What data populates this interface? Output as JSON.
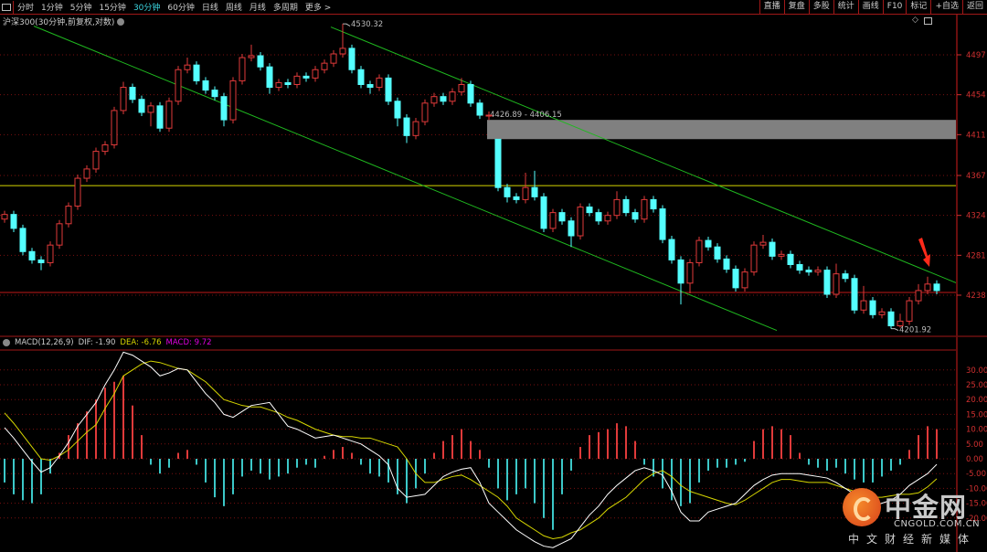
{
  "toolbar": {
    "tabs": [
      "分时",
      "1分钟",
      "5分钟",
      "15分钟",
      "30分钟",
      "60分钟",
      "日线",
      "周线",
      "月线",
      "多周期",
      "更多 >"
    ],
    "active_tab": "30分钟",
    "right_buttons": [
      "直播",
      "复盘",
      "多股",
      "统计",
      "画线",
      "F10",
      "标记",
      "+自选",
      "返回"
    ]
  },
  "subtitle": "沪深300(30分钟,前复权,对数)",
  "macd_header": {
    "name": "MACD(12,26,9)",
    "dif": "DIF: -1.90",
    "dea": "DEA: -6.76",
    "macd": "MACD: 9.72"
  },
  "colors": {
    "background": "#000000",
    "up": "#e03a3a",
    "down": "#54ffff",
    "grid": "#7a1010",
    "axis_text": "#d03030",
    "channel": "#1fb81f",
    "dif": "#ffffff",
    "dea": "#d6d600",
    "macd_text": "#e000e0",
    "gap_box": "#808080",
    "arrow": "#ff2a1a"
  },
  "watermark": {
    "brand": "中金网",
    "url": "CNGOLD.COM.CN",
    "slogan": "中文财经新媒体"
  },
  "chart_data": [
    {
      "type": "candlestick",
      "title": "沪深300(30分钟,前复权,对数)",
      "y_scale": "log",
      "y_ticks": [
        4497,
        4454,
        4411,
        4367,
        4324,
        4281,
        4238
      ],
      "grid": true,
      "candles_ohlc": [
        [
          4320,
          4329,
          4316,
          4325
        ],
        [
          4325,
          4329,
          4306,
          4310
        ],
        [
          4310,
          4314,
          4281,
          4285
        ],
        [
          4285,
          4289,
          4272,
          4276
        ],
        [
          4276,
          4280,
          4265,
          4273
        ],
        [
          4273,
          4296,
          4269,
          4292
        ],
        [
          4292,
          4319,
          4288,
          4315
        ],
        [
          4315,
          4338,
          4311,
          4334
        ],
        [
          4334,
          4368,
          4330,
          4364
        ],
        [
          4364,
          4378,
          4360,
          4374
        ],
        [
          4374,
          4397,
          4370,
          4393
        ],
        [
          4393,
          4404,
          4389,
          4400
        ],
        [
          4400,
          4441,
          4396,
          4437
        ],
        [
          4437,
          4468,
          4433,
          4462
        ],
        [
          4462,
          4466,
          4445,
          4449
        ],
        [
          4449,
          4453,
          4431,
          4435
        ],
        [
          4435,
          4446,
          4420,
          4442
        ],
        [
          4442,
          4446,
          4414,
          4418
        ],
        [
          4418,
          4451,
          4414,
          4447
        ],
        [
          4447,
          4485,
          4443,
          4481
        ],
        [
          4481,
          4494,
          4477,
          4486
        ],
        [
          4486,
          4490,
          4465,
          4469
        ],
        [
          4469,
          4473,
          4455,
          4459
        ],
        [
          4459,
          4463,
          4448,
          4452
        ],
        [
          4452,
          4456,
          4420,
          4427
        ],
        [
          4427,
          4473,
          4423,
          4469
        ],
        [
          4469,
          4498,
          4465,
          4494
        ],
        [
          4494,
          4508,
          4490,
          4496
        ],
        [
          4496,
          4500,
          4480,
          4484
        ],
        [
          4484,
          4488,
          4455,
          4462
        ],
        [
          4462,
          4471,
          4458,
          4467
        ],
        [
          4467,
          4471,
          4461,
          4465
        ],
        [
          4465,
          4478,
          4461,
          4474
        ],
        [
          4474,
          4478,
          4468,
          4472
        ],
        [
          4472,
          4485,
          4468,
          4481
        ],
        [
          4481,
          4492,
          4477,
          4488
        ],
        [
          4488,
          4502,
          4484,
          4498
        ],
        [
          4498,
          4530.32,
          4494,
          4504
        ],
        [
          4504,
          4508,
          4477,
          4481
        ],
        [
          4481,
          4485,
          4461,
          4465
        ],
        [
          4465,
          4469,
          4455,
          4462
        ],
        [
          4462,
          4476,
          4458,
          4472
        ],
        [
          4472,
          4476,
          4443,
          4447
        ],
        [
          4447,
          4451,
          4420,
          4429
        ],
        [
          4429,
          4433,
          4402,
          4410
        ],
        [
          4410,
          4429,
          4406,
          4425
        ],
        [
          4425,
          4449,
          4421,
          4445
        ],
        [
          4445,
          4456,
          4441,
          4452
        ],
        [
          4452,
          4456,
          4443,
          4447
        ],
        [
          4447,
          4461,
          4443,
          4457
        ],
        [
          4457,
          4472,
          4453,
          4465
        ],
        [
          4465,
          4469,
          4441,
          4445
        ],
        [
          4445,
          4449,
          4428,
          4432
        ],
        [
          4432,
          4436,
          4426.89,
          4432
        ],
        [
          4406,
          4406.15,
          4350,
          4354
        ],
        [
          4354,
          4358,
          4338,
          4344
        ],
        [
          4344,
          4348,
          4337,
          4341
        ],
        [
          4341,
          4370,
          4337,
          4354
        ],
        [
          4354,
          4372,
          4340,
          4344
        ],
        [
          4344,
          4348,
          4306,
          4310
        ],
        [
          4310,
          4331,
          4306,
          4327
        ],
        [
          4327,
          4331,
          4314,
          4318
        ],
        [
          4318,
          4322,
          4290,
          4302
        ],
        [
          4302,
          4337,
          4298,
          4333
        ],
        [
          4333,
          4337,
          4323,
          4327
        ],
        [
          4327,
          4331,
          4314,
          4318
        ],
        [
          4318,
          4328,
          4314,
          4324
        ],
        [
          4324,
          4350,
          4320,
          4341
        ],
        [
          4341,
          4345,
          4323,
          4327
        ],
        [
          4327,
          4331,
          4316,
          4320
        ],
        [
          4320,
          4345,
          4316,
          4341
        ],
        [
          4341,
          4345,
          4327,
          4331
        ],
        [
          4331,
          4335,
          4294,
          4298
        ],
        [
          4298,
          4302,
          4272,
          4276
        ],
        [
          4276,
          4280,
          4228,
          4251
        ],
        [
          4251,
          4277,
          4240,
          4273
        ],
        [
          4273,
          4301,
          4269,
          4297
        ],
        [
          4297,
          4301,
          4286,
          4290
        ],
        [
          4290,
          4294,
          4273,
          4277
        ],
        [
          4277,
          4281,
          4262,
          4266
        ],
        [
          4266,
          4270,
          4242,
          4246
        ],
        [
          4246,
          4267,
          4242,
          4263
        ],
        [
          4263,
          4296,
          4259,
          4292
        ],
        [
          4292,
          4303,
          4288,
          4295
        ],
        [
          4295,
          4299,
          4276,
          4280
        ],
        [
          4280,
          4286,
          4276,
          4282
        ],
        [
          4282,
          4286,
          4267,
          4271
        ],
        [
          4271,
          4275,
          4261,
          4265
        ],
        [
          4265,
          4269,
          4259,
          4263
        ],
        [
          4263,
          4269,
          4259,
          4265
        ],
        [
          4265,
          4269,
          4235,
          4239
        ],
        [
          4239,
          4272,
          4235,
          4261
        ],
        [
          4261,
          4265,
          4252,
          4256
        ],
        [
          4256,
          4260,
          4218,
          4222
        ],
        [
          4222,
          4248,
          4218,
          4232
        ],
        [
          4232,
          4236,
          4213,
          4217
        ],
        [
          4217,
          4224,
          4213,
          4220
        ],
        [
          4220,
          4224,
          4201.92,
          4205
        ],
        [
          4205,
          4218,
          4203,
          4210
        ],
        [
          4210,
          4236,
          4206,
          4232
        ],
        [
          4232,
          4250,
          4228,
          4243
        ],
        [
          4243,
          4258,
          4239,
          4250
        ],
        [
          4250,
          4254,
          4239,
          4243
        ]
      ],
      "annotations": {
        "high_label": "4530.32",
        "low_label": "4201.92",
        "gap_label": "4426.89 - 4406.15",
        "gap_range": [
          4406.15,
          4426.89
        ],
        "horizontal_lines": [
          {
            "price": 4356,
            "color": "#d6d600"
          },
          {
            "price": 4241,
            "color": "#c01818"
          }
        ],
        "channel_upper": [
          [
            35.7,
            4527
          ],
          [
            104.2,
            4251
          ]
        ],
        "channel_lower": [
          [
            3.2,
            4528
          ],
          [
            84.5,
            4200
          ]
        ],
        "arrow_at_candle": 100
      }
    },
    {
      "type": "macd",
      "title": "MACD(12,26,9)",
      "y_ticks": [
        30,
        25,
        20,
        15,
        10,
        5,
        0,
        -5,
        -10,
        -15,
        -20
      ],
      "ylim": [
        -30,
        36
      ],
      "dif": [
        10.5,
        7,
        3,
        -1,
        -4.5,
        -3,
        1,
        5.5,
        11,
        15,
        19,
        25,
        30,
        36,
        35,
        33,
        31,
        28,
        29,
        30.5,
        30,
        26,
        22,
        19,
        15,
        14,
        16,
        18,
        18.5,
        19,
        15,
        11,
        10,
        8.5,
        7,
        7.5,
        8,
        7,
        6,
        5,
        3,
        1,
        -2,
        -10,
        -13,
        -12.5,
        -12,
        -9,
        -6,
        -4.5,
        -3.5,
        -3,
        -8,
        -15,
        -18,
        -21,
        -24,
        -26,
        -28,
        -29.5,
        -30,
        -28.5,
        -27,
        -23,
        -19,
        -16,
        -12,
        -9,
        -6.5,
        -4,
        -3,
        -4,
        -5.5,
        -11,
        -18,
        -21,
        -21,
        -18,
        -17,
        -16,
        -15,
        -12,
        -9,
        -7,
        -5.5,
        -5,
        -5,
        -5,
        -5.5,
        -6,
        -6.5,
        -8,
        -10,
        -12,
        -15,
        -16,
        -15,
        -14,
        -12,
        -9,
        -7,
        -5,
        -1.9
      ],
      "dea": [
        15.5,
        12,
        8,
        4,
        0,
        -0.5,
        1,
        3,
        6,
        9,
        11.5,
        17,
        22,
        28,
        30,
        32,
        33,
        32.5,
        31.5,
        30.5,
        30,
        28,
        26,
        23,
        20,
        19,
        18,
        17.5,
        17.5,
        16.5,
        15.5,
        14,
        13,
        11.5,
        10,
        9,
        8,
        7.5,
        7.5,
        7,
        7,
        6,
        5,
        4,
        0,
        -5,
        -8,
        -8,
        -7,
        -6,
        -5.5,
        -7,
        -9,
        -11,
        -13,
        -16,
        -20,
        -22,
        -24,
        -26,
        -27,
        -26.5,
        -25,
        -24,
        -22,
        -20,
        -17,
        -15,
        -13,
        -10,
        -7,
        -5,
        -4,
        -6,
        -9,
        -11,
        -12,
        -13,
        -14,
        -15,
        -15.5,
        -14,
        -12,
        -10,
        -8,
        -7,
        -7,
        -7.5,
        -8,
        -8,
        -8,
        -9,
        -10,
        -11,
        -12.5,
        -13,
        -13,
        -12.5,
        -12,
        -12,
        -11.5,
        -9.5,
        -6.76
      ],
      "histogram": [
        -8,
        -12,
        -14,
        -15,
        -12,
        -5,
        2,
        8,
        12,
        16,
        20,
        24,
        26,
        28,
        18,
        8,
        -2,
        -5,
        -3,
        2,
        3,
        -2,
        -8,
        -13,
        -16,
        -12,
        -6,
        -4,
        -5,
        -7,
        -6,
        -5,
        -3,
        -2,
        -3,
        1,
        3,
        4,
        2,
        -2,
        -5,
        -6,
        -8,
        -12,
        -15,
        -10,
        -5,
        2,
        6,
        8,
        10,
        6,
        3,
        -3,
        -10,
        -14,
        -12,
        -10,
        -15,
        -20,
        -24,
        -12,
        -4,
        4,
        8,
        9,
        10,
        12,
        11,
        6,
        -2,
        -6,
        -10,
        -14,
        -16,
        -15,
        -8,
        -4,
        -3,
        -3,
        -2,
        -1,
        6,
        10,
        11,
        10,
        8,
        2,
        -2,
        -3,
        -4,
        -3,
        -5,
        -7,
        -8,
        -8,
        -6,
        -4,
        -2,
        3,
        8,
        11,
        10
      ]
    }
  ]
}
